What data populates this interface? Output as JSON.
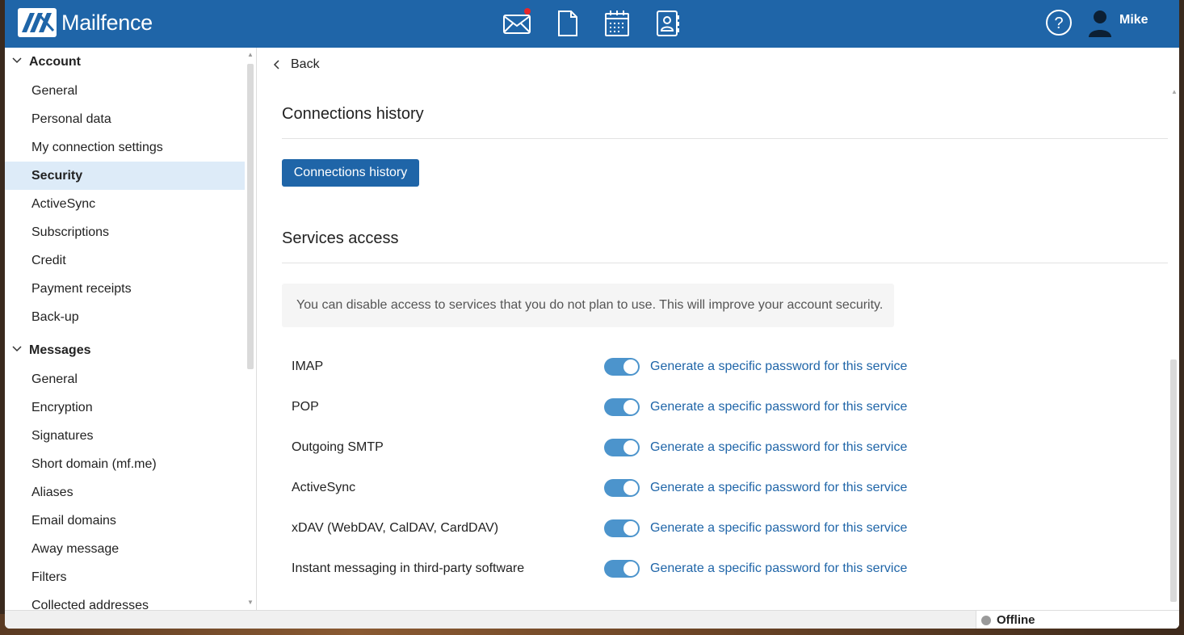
{
  "brand": {
    "name": "Mailfence"
  },
  "topbar": {
    "apps": [
      {
        "icon": "mail-icon",
        "has_notification": true
      },
      {
        "icon": "document-icon"
      },
      {
        "icon": "calendar-icon"
      },
      {
        "icon": "contacts-icon"
      }
    ],
    "help_icon": "help-icon",
    "user": {
      "name": "Mike",
      "icon": "user-avatar-icon"
    }
  },
  "sidebar": {
    "groups": [
      {
        "label": "Account",
        "items": [
          "General",
          "Personal data",
          "My connection settings",
          "Security",
          "ActiveSync",
          "Subscriptions",
          "Credit",
          "Payment receipts",
          "Back-up"
        ],
        "active": "Security"
      },
      {
        "label": "Messages",
        "items": [
          "General",
          "Encryption",
          "Signatures",
          "Short domain (mf.me)",
          "Aliases",
          "Email domains",
          "Away message",
          "Filters",
          "Collected addresses"
        ]
      }
    ]
  },
  "main": {
    "back_label": "Back",
    "connections": {
      "title": "Connections history",
      "button_label": "Connections history"
    },
    "services": {
      "title": "Services access",
      "info": "You can disable access to services that you do not plan to use. This will improve your account security.",
      "link_label": "Generate a specific password for this service",
      "rows": [
        {
          "name": "IMAP",
          "enabled": true
        },
        {
          "name": "POP",
          "enabled": true
        },
        {
          "name": "Outgoing SMTP",
          "enabled": true
        },
        {
          "name": "ActiveSync",
          "enabled": true
        },
        {
          "name": "xDAV (WebDAV, CalDAV, CardDAV)",
          "enabled": true
        },
        {
          "name": "Instant messaging in third-party software",
          "enabled": true
        }
      ]
    }
  },
  "status": {
    "label": "Offline"
  },
  "colors": {
    "brand": "#1f65a8",
    "toggle_on": "#4c94cc",
    "active_item_bg": "#ddebf8"
  }
}
